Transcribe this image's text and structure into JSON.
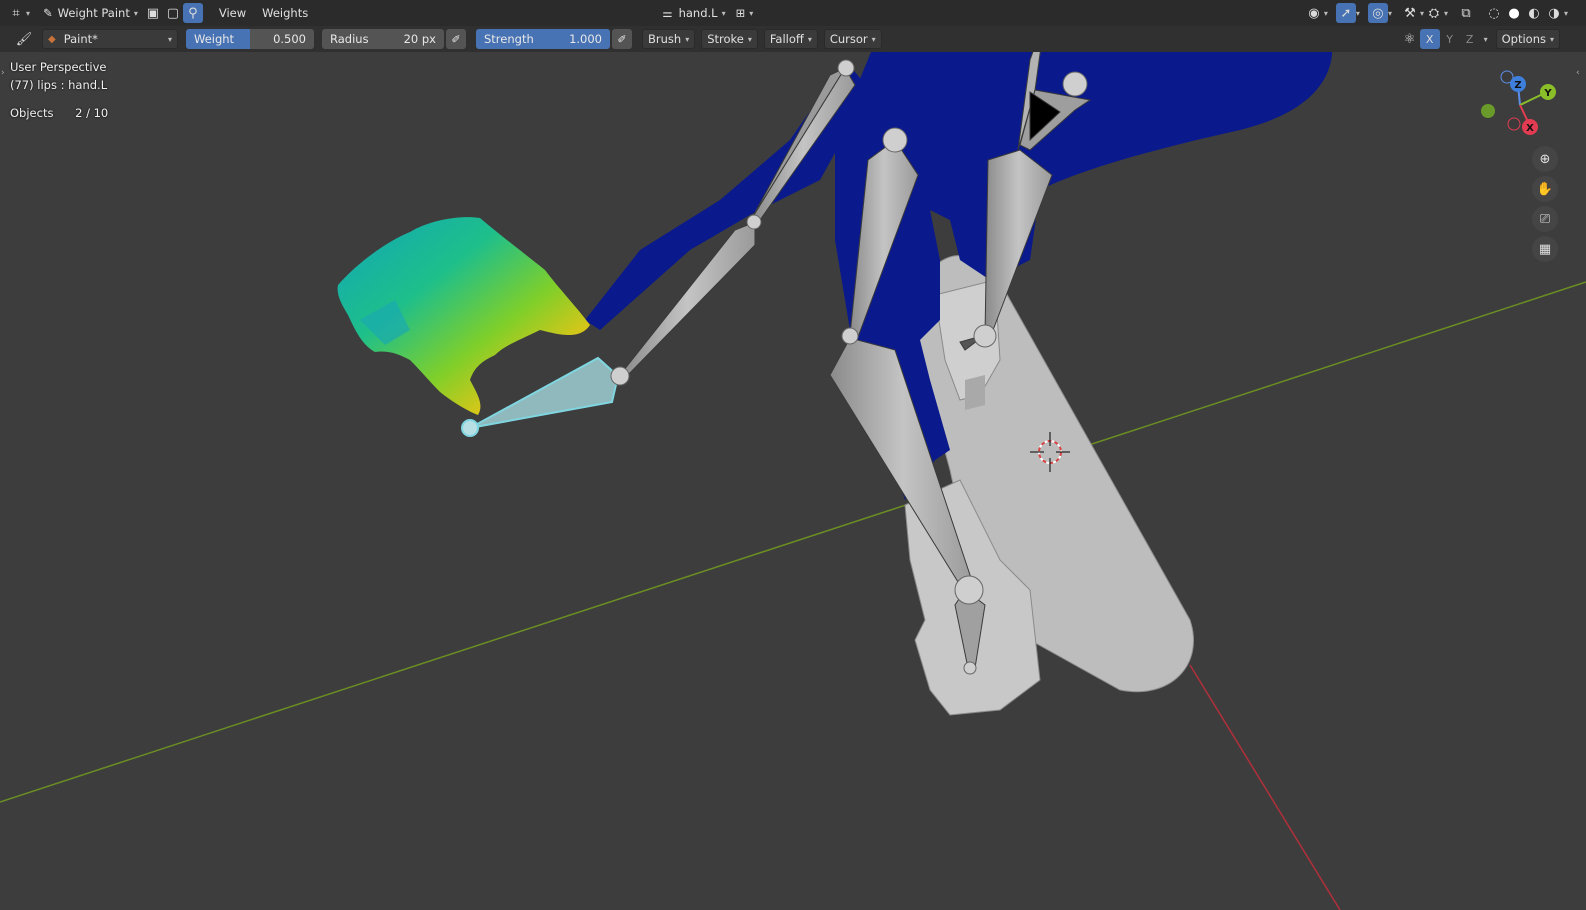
{
  "header": {
    "mode_label": "Weight Paint",
    "menus": [
      "View",
      "Weights"
    ],
    "active_object": "hand.L",
    "options_label": "Options",
    "axis": {
      "x": "X",
      "y": "Y",
      "z": "Z"
    }
  },
  "tool_settings": {
    "brush_name": "Paint*",
    "weight": {
      "label": "Weight",
      "value": "0.500",
      "fraction": 0.5
    },
    "radius": {
      "label": "Radius",
      "value": "20 px"
    },
    "strength": {
      "label": "Strength",
      "value": "1.000",
      "fraction": 1.0
    },
    "menus": [
      "Brush",
      "Stroke",
      "Falloff",
      "Cursor"
    ]
  },
  "viewport": {
    "perspective": "User Perspective",
    "context": "(77) lips : hand.L",
    "objects_label": "Objects",
    "objects_value": "2 / 10"
  },
  "gizmo": {
    "z": "Z",
    "y": "Y",
    "x": "X"
  },
  "colors": {
    "accent": "#4772b3",
    "mesh_blue": "#0a1a8c",
    "bone_gray": "#a8a8a8",
    "selected_bone": "#7fd6e0",
    "x_axis": "#b0303a",
    "y_axis": "#6b8e23"
  }
}
